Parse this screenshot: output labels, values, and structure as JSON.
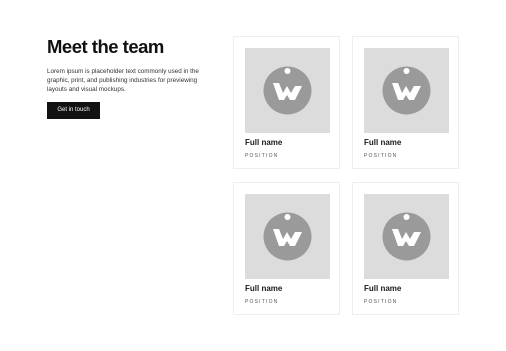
{
  "intro": {
    "title": "Meet the team",
    "description": "Lorem ipsum is placeholder text commonly used in the graphic, print, and publishing industries for previewing layouts and visual mockups.",
    "cta_label": "Get in touch"
  },
  "colors": {
    "button_background": "#121212",
    "photo_placeholder": "#dcdcdc",
    "logo_badge": "#9a9a9a"
  },
  "team": [
    {
      "name": "Full name",
      "position": "POSITION",
      "photo_icon": "placeholder-logo-icon"
    },
    {
      "name": "Full name",
      "position": "POSITION",
      "photo_icon": "placeholder-logo-icon"
    },
    {
      "name": "Full name",
      "position": "POSITION",
      "photo_icon": "placeholder-logo-icon"
    },
    {
      "name": "Full name",
      "position": "POSITION",
      "photo_icon": "placeholder-logo-icon"
    }
  ]
}
